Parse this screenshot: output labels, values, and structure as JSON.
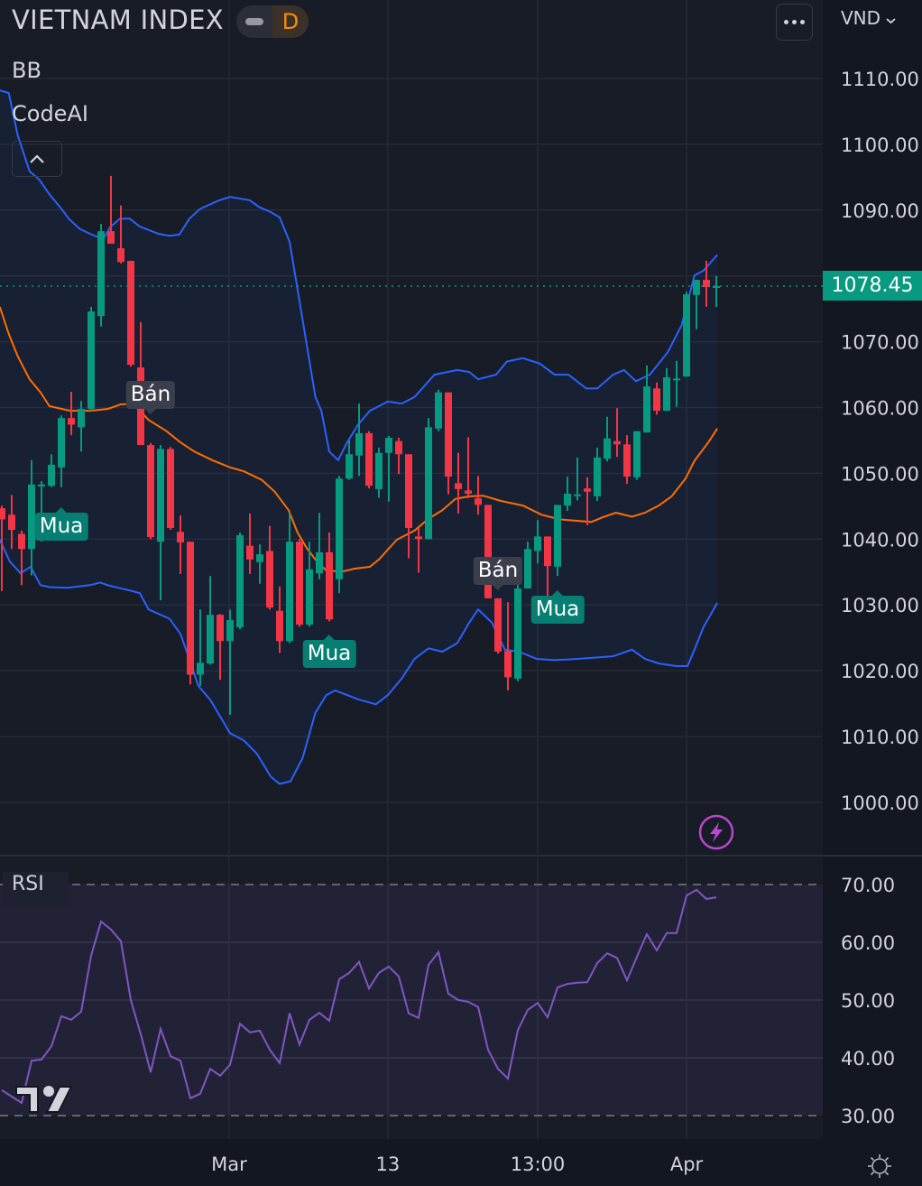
{
  "header": {
    "symbol": "VIETNAM INDEX",
    "interval": "D",
    "currency": "VND"
  },
  "indicators": {
    "bb": "BB",
    "codeai": "CodeAI",
    "rsi": "RSI"
  },
  "colors": {
    "up": "#089981",
    "down": "#f23645",
    "bb_band": "#2962ff",
    "bb_basis": "#ff6d00",
    "rsi": "#7e57c2",
    "price_line": "#089981"
  },
  "chart_data": [
    {
      "type": "candlestick",
      "title": "VIETNAM INDEX",
      "ylim": [
        995,
        1116
      ],
      "yticks": [
        "1110.00",
        "1100.00",
        "1090.00",
        "1080.00",
        "1070.00",
        "1060.00",
        "1050.00",
        "1040.00",
        "1030.00",
        "1020.00",
        "1010.00",
        "1000.00"
      ],
      "ytick_values": [
        1110,
        1100,
        1090,
        1080,
        1070,
        1060,
        1050,
        1040,
        1030,
        1020,
        1010,
        1000
      ],
      "last_price": "1078.45",
      "last_price_value": 1078.45,
      "xticks": [
        {
          "label": "Mar",
          "index": 22.9
        },
        {
          "label": "13",
          "index": 38.9
        },
        {
          "label": "13:00",
          "index": 54
        },
        {
          "label": "Apr",
          "index": 69
        }
      ],
      "ohlc": [
        [
          1044.7,
          1043.0,
          1045.1,
          1032.1
        ],
        [
          1043.7,
          1041.4,
          1046.7,
          1038.5
        ],
        [
          1040.8,
          1038.5,
          1041.3,
          1033.0
        ],
        [
          1038.5,
          1048.3,
          1052.0,
          1034.5
        ],
        [
          1048.0,
          1048.3,
          1048.8,
          1039.6
        ],
        [
          1048.1,
          1051.3,
          1052.9,
          1047.9
        ],
        [
          1050.9,
          1058.4,
          1058.8,
          1047.9
        ],
        [
          1058.4,
          1057.4,
          1062.4,
          1055.8
        ],
        [
          1057.0,
          1059.8,
          1061.0,
          1053.3
        ],
        [
          1059.8,
          1074.6,
          1075.3,
          1059.5
        ],
        [
          1073.9,
          1086.8,
          1087.9,
          1072.3
        ],
        [
          1086.8,
          1084.9,
          1095.2,
          1084.9
        ],
        [
          1084.2,
          1082.1,
          1090.7,
          1081.9
        ],
        [
          1082.3,
          1066.5,
          1082.3,
          1066.2
        ],
        [
          1066.1,
          1054.3,
          1073.0,
          1054.3
        ],
        [
          1054.3,
          1040.3,
          1054.6,
          1040.0
        ],
        [
          1039.6,
          1053.7,
          1054.3,
          1030.7
        ],
        [
          1053.7,
          1041.7,
          1054.0,
          1041.4
        ],
        [
          1041.1,
          1039.5,
          1043.6,
          1034.7
        ],
        [
          1039.6,
          1019.4,
          1039.6,
          1017.9
        ],
        [
          1019.4,
          1021.2,
          1029.3,
          1017.7
        ],
        [
          1021.1,
          1028.5,
          1034.4,
          1020.9
        ],
        [
          1028.5,
          1024.5,
          1028.6,
          1018.6
        ],
        [
          1024.5,
          1027.7,
          1029.3,
          1013.3
        ],
        [
          1026.6,
          1040.6,
          1041.0,
          1026.3
        ],
        [
          1039.0,
          1036.9,
          1043.9,
          1034.7
        ],
        [
          1036.5,
          1037.7,
          1039.2,
          1033.2
        ],
        [
          1038.2,
          1029.6,
          1042.0,
          1029.3
        ],
        [
          1029.1,
          1024.5,
          1032.8,
          1022.7
        ],
        [
          1024.5,
          1039.6,
          1044.0,
          1024.2
        ],
        [
          1039.6,
          1027.0,
          1040.0,
          1026.7
        ],
        [
          1027.0,
          1035.4,
          1039.6,
          1026.7
        ],
        [
          1034.8,
          1038.0,
          1044.0,
          1033.9
        ],
        [
          1038.0,
          1027.8,
          1041.0,
          1027.5
        ],
        [
          1033.9,
          1049.2,
          1049.6,
          1031.8
        ],
        [
          1049.2,
          1052.9,
          1055.0,
          1049.0
        ],
        [
          1052.7,
          1056.1,
          1060.6,
          1049.6
        ],
        [
          1056.1,
          1048.1,
          1056.4,
          1047.7
        ],
        [
          1047.6,
          1053.1,
          1053.9,
          1046.3
        ],
        [
          1053.1,
          1055.4,
          1055.7,
          1045.7
        ],
        [
          1054.9,
          1052.9,
          1055.4,
          1049.9
        ],
        [
          1052.9,
          1041.7,
          1052.9,
          1037.1
        ],
        [
          1040.4,
          1040.0,
          1041.7,
          1034.9
        ],
        [
          1040.0,
          1057.0,
          1058.4,
          1040.0
        ],
        [
          1056.8,
          1062.3,
          1062.7,
          1056.4
        ],
        [
          1062.3,
          1049.5,
          1062.3,
          1046.8
        ],
        [
          1048.5,
          1047.6,
          1053.1,
          1043.9
        ],
        [
          1047.4,
          1046.9,
          1055.5,
          1046.2
        ],
        [
          1046.2,
          1045.2,
          1049.6,
          1043.7
        ],
        [
          1045.2,
          1031.0,
          1045.2,
          1031.0
        ],
        [
          1031.0,
          1022.9,
          1031.0,
          1022.6
        ],
        [
          1023.0,
          1019.0,
          1030.4,
          1017.0
        ],
        [
          1018.8,
          1032.5,
          1036.2,
          1018.4
        ],
        [
          1032.5,
          1038.5,
          1039.6,
          1032.5
        ],
        [
          1038.2,
          1040.4,
          1042.9,
          1036.3
        ],
        [
          1040.4,
          1035.9,
          1040.4,
          1031.0
        ],
        [
          1035.8,
          1045.2,
          1045.2,
          1034.4
        ],
        [
          1045.1,
          1046.9,
          1049.5,
          1044.3
        ],
        [
          1046.6,
          1046.8,
          1052.4,
          1045.9
        ],
        [
          1047.7,
          1047.2,
          1049.4,
          1042.1
        ],
        [
          1046.5,
          1052.4,
          1053.9,
          1045.8
        ],
        [
          1052.2,
          1055.3,
          1058.6,
          1051.8
        ],
        [
          1054.9,
          1054.4,
          1059.9,
          1052.5
        ],
        [
          1054.4,
          1049.5,
          1055.8,
          1048.4
        ],
        [
          1049.4,
          1056.4,
          1056.4,
          1049.0
        ],
        [
          1056.2,
          1063.2,
          1066.4,
          1056.2
        ],
        [
          1062.9,
          1059.5,
          1063.8,
          1058.9
        ],
        [
          1059.5,
          1064.6,
          1066.0,
          1059.5
        ],
        [
          1064.2,
          1064.4,
          1067.1,
          1060.1
        ],
        [
          1064.7,
          1077.2,
          1077.6,
          1064.7
        ],
        [
          1077.1,
          1079.4,
          1079.4,
          1071.9
        ],
        [
          1079.4,
          1078.3,
          1082.3,
          1075.3
        ],
        [
          1078.3,
          1078.45,
          1080.0,
          1075.3
        ]
      ],
      "bb_upper": [
        [
          -0.2,
          1108.2
        ],
        [
          0.7,
          1107.8
        ],
        [
          1.6,
          1101.4
        ],
        [
          2.8,
          1095.9
        ],
        [
          3.8,
          1094.6
        ],
        [
          4.8,
          1092.4
        ],
        [
          6,
          1090.2
        ],
        [
          6.8,
          1088.6
        ],
        [
          7.9,
          1087.1
        ],
        [
          9.5,
          1086.0
        ],
        [
          10.4,
          1086.0
        ],
        [
          10.9,
          1087.4
        ],
        [
          11.9,
          1088.7
        ],
        [
          12.9,
          1088.7
        ],
        [
          13.9,
          1087.5
        ],
        [
          15.8,
          1086.4
        ],
        [
          16.9,
          1086.1
        ],
        [
          17.9,
          1086.3
        ],
        [
          18.9,
          1088.7
        ],
        [
          20,
          1090.2
        ],
        [
          21.9,
          1091.5
        ],
        [
          23,
          1092.0
        ],
        [
          25,
          1091.5
        ],
        [
          25.9,
          1090.5
        ],
        [
          27.1,
          1089.7
        ],
        [
          28,
          1088.9
        ],
        [
          29,
          1085.2
        ],
        [
          29.8,
          1078.0
        ],
        [
          30.7,
          1069.8
        ],
        [
          31.6,
          1061.6
        ],
        [
          32.2,
          1059.5
        ],
        [
          33,
          1053.3
        ],
        [
          33.9,
          1052.0
        ],
        [
          34.8,
          1054.7
        ],
        [
          35.9,
          1057.4
        ],
        [
          37.1,
          1059.5
        ],
        [
          38.9,
          1060.9
        ],
        [
          40.3,
          1060.6
        ],
        [
          41.6,
          1061.6
        ],
        [
          43.6,
          1065.0
        ],
        [
          45.9,
          1065.7
        ],
        [
          47.1,
          1065.4
        ],
        [
          48,
          1064.3
        ],
        [
          49.8,
          1065.0
        ],
        [
          50.9,
          1067.0
        ],
        [
          52.5,
          1067.5
        ],
        [
          54.2,
          1066.7
        ],
        [
          55.7,
          1065.0
        ],
        [
          57.1,
          1065.0
        ],
        [
          58.9,
          1062.9
        ],
        [
          60,
          1062.9
        ],
        [
          61.6,
          1065.0
        ],
        [
          62.7,
          1065.7
        ],
        [
          63.9,
          1064.0
        ],
        [
          65.3,
          1065.0
        ],
        [
          67.1,
          1068.4
        ],
        [
          68.5,
          1072.5
        ],
        [
          69.8,
          1080.1
        ],
        [
          70.7,
          1080.8
        ],
        [
          72.1,
          1083.2
        ]
      ],
      "bb_basis": [
        [
          -0.2,
          1075.3
        ],
        [
          0.7,
          1071.2
        ],
        [
          1.6,
          1067.8
        ],
        [
          2.8,
          1064.3
        ],
        [
          3.9,
          1062.3
        ],
        [
          4.8,
          1060.2
        ],
        [
          6.9,
          1059.5
        ],
        [
          8.9,
          1059.5
        ],
        [
          10.7,
          1059.8
        ],
        [
          12,
          1060.5
        ],
        [
          13.3,
          1060.5
        ],
        [
          14.8,
          1058.1
        ],
        [
          16.6,
          1056.4
        ],
        [
          18,
          1054.7
        ],
        [
          19.4,
          1053.3
        ],
        [
          21.2,
          1052.0
        ],
        [
          23,
          1050.9
        ],
        [
          24.4,
          1050.3
        ],
        [
          26.2,
          1049.0
        ],
        [
          27.5,
          1047.2
        ],
        [
          28.9,
          1044.4
        ],
        [
          29.8,
          1041.0
        ],
        [
          30.7,
          1038.7
        ],
        [
          31.6,
          1036.9
        ],
        [
          32.7,
          1035.2
        ],
        [
          34.4,
          1035.1
        ],
        [
          35.5,
          1035.5
        ],
        [
          37.1,
          1035.8
        ],
        [
          38,
          1036.9
        ],
        [
          39.8,
          1039.9
        ],
        [
          41.6,
          1041.3
        ],
        [
          43,
          1043.1
        ],
        [
          44.4,
          1044.4
        ],
        [
          45.7,
          1046.1
        ],
        [
          47.1,
          1046.5
        ],
        [
          48.5,
          1046.6
        ],
        [
          50.3,
          1045.8
        ],
        [
          52.5,
          1045.1
        ],
        [
          54.4,
          1043.7
        ],
        [
          56.2,
          1043.0
        ],
        [
          59.4,
          1042.6
        ],
        [
          60.7,
          1043.4
        ],
        [
          61.9,
          1044.0
        ],
        [
          63.5,
          1043.4
        ],
        [
          64.8,
          1044.0
        ],
        [
          66.2,
          1045.1
        ],
        [
          67.5,
          1046.5
        ],
        [
          68.9,
          1049.2
        ],
        [
          69.8,
          1051.9
        ],
        [
          71.2,
          1054.7
        ],
        [
          72.1,
          1056.8
        ]
      ],
      "bb_lower": [
        [
          -0.2,
          1039.9
        ],
        [
          0.8,
          1036.6
        ],
        [
          1.9,
          1034.8
        ],
        [
          2.9,
          1035.8
        ],
        [
          3.9,
          1033.0
        ],
        [
          4.8,
          1032.7
        ],
        [
          6.6,
          1032.6
        ],
        [
          8.9,
          1033.0
        ],
        [
          9.9,
          1033.4
        ],
        [
          10.9,
          1032.9
        ],
        [
          12.9,
          1032.2
        ],
        [
          13.9,
          1031.8
        ],
        [
          14.8,
          1029.3
        ],
        [
          16.9,
          1027.9
        ],
        [
          18,
          1025.6
        ],
        [
          18.9,
          1021.8
        ],
        [
          19.8,
          1017.7
        ],
        [
          21,
          1015.6
        ],
        [
          23,
          1010.5
        ],
        [
          24.4,
          1009.4
        ],
        [
          25.7,
          1007.4
        ],
        [
          27.1,
          1003.9
        ],
        [
          28,
          1002.8
        ],
        [
          29.1,
          1003.2
        ],
        [
          30.3,
          1006.7
        ],
        [
          31.6,
          1013.6
        ],
        [
          32.7,
          1016.3
        ],
        [
          33.6,
          1017.0
        ],
        [
          36,
          1015.6
        ],
        [
          37.7,
          1014.9
        ],
        [
          38.9,
          1016.3
        ],
        [
          40.3,
          1018.8
        ],
        [
          41.6,
          1021.8
        ],
        [
          43,
          1023.4
        ],
        [
          44.4,
          1022.9
        ],
        [
          45.9,
          1024.2
        ],
        [
          47.1,
          1027.3
        ],
        [
          48,
          1029.3
        ],
        [
          49.4,
          1027.3
        ],
        [
          50.7,
          1023.2
        ],
        [
          52.1,
          1022.9
        ],
        [
          53.9,
          1021.8
        ],
        [
          55.7,
          1021.6
        ],
        [
          58,
          1021.8
        ],
        [
          61.6,
          1022.2
        ],
        [
          63.5,
          1023.2
        ],
        [
          64.8,
          1021.8
        ],
        [
          66.2,
          1021.1
        ],
        [
          68,
          1020.7
        ],
        [
          69.1,
          1020.7
        ],
        [
          69.8,
          1023.2
        ],
        [
          70.7,
          1026.6
        ],
        [
          72.1,
          1030.3
        ]
      ],
      "signals": [
        {
          "label": "Mua",
          "kind": "buy",
          "index": 6,
          "price": 1042.0
        },
        {
          "label": "Bán",
          "kind": "sell",
          "index": 15,
          "price": 1062.0
        },
        {
          "label": "Mua",
          "kind": "buy",
          "index": 33,
          "price": 1022.6
        },
        {
          "label": "Bán",
          "kind": "sell",
          "index": 50,
          "price": 1035.2
        },
        {
          "label": "Mua",
          "kind": "buy",
          "index": 56,
          "price": 1029.3
        }
      ]
    },
    {
      "type": "line",
      "title": "RSI",
      "ylim": [
        26,
        72
      ],
      "yticks": [
        "70.00",
        "60.00",
        "50.00",
        "40.00",
        "30.00"
      ],
      "ytick_values": [
        70,
        60,
        50,
        40,
        30
      ],
      "band": [
        30,
        70
      ],
      "values": [
        34.4,
        33.3,
        32.2,
        39.5,
        39.7,
        42.0,
        47.2,
        46.6,
        48.0,
        57.7,
        63.6,
        62.2,
        60.2,
        50.0,
        44.1,
        37.5,
        45.0,
        40.3,
        39.5,
        33.0,
        33.8,
        38.1,
        36.9,
        38.8,
        45.9,
        44.4,
        44.7,
        41.4,
        39.1,
        47.7,
        42.3,
        46.6,
        47.8,
        46.4,
        53.6,
        54.7,
        56.6,
        52.0,
        54.7,
        55.8,
        54.1,
        47.7,
        46.9,
        56.1,
        58.3,
        51.1,
        50.0,
        49.7,
        48.8,
        41.4,
        38.1,
        36.4,
        44.8,
        48.3,
        49.5,
        47.0,
        52.2,
        52.8,
        53.0,
        53.1,
        56.4,
        58.1,
        57.3,
        53.4,
        57.5,
        61.4,
        58.6,
        61.6,
        61.6,
        68.1,
        69.1,
        67.5,
        67.8
      ]
    }
  ]
}
